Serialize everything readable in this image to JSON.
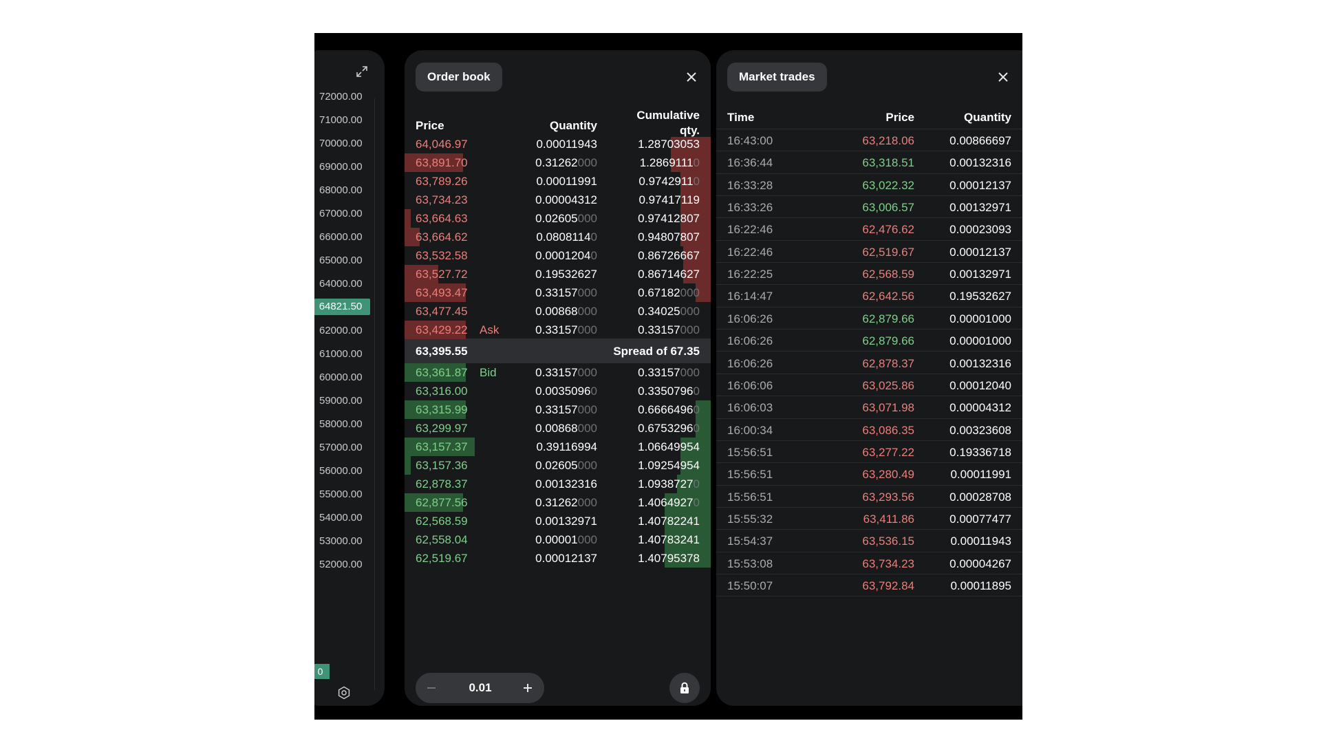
{
  "axis": {
    "labels": [
      "72000.00",
      "71000.00",
      "70000.00",
      "69000.00",
      "68000.00",
      "67000.00",
      "66000.00",
      "65000.00",
      "64000.00",
      "63000.00",
      "62000.00",
      "61000.00",
      "60000.00",
      "59000.00",
      "58000.00",
      "57000.00",
      "56000.00",
      "55000.00",
      "54000.00",
      "53000.00",
      "52000.00"
    ],
    "current_price": "64821.50",
    "zero_badge": "0"
  },
  "order_book": {
    "title": "Order book",
    "headers": {
      "price": "Price",
      "quantity": "Quantity",
      "cumulative": "Cumulative qty."
    },
    "asks": [
      {
        "price": "64,046.97",
        "qty": "0.00011943",
        "qty_dim": "",
        "cum": "1.28703053",
        "cum_dim": "",
        "size_pct": 0,
        "cum_pct": 13
      },
      {
        "price": "63,891.70",
        "qty": "0.31262",
        "qty_dim": "000",
        "cum": "1.2869111",
        "cum_dim": "0",
        "size_pct": 19,
        "cum_pct": 13
      },
      {
        "price": "63,789.26",
        "qty": "0.00011991",
        "qty_dim": "",
        "cum": "0.9742911",
        "cum_dim": "0",
        "size_pct": 0,
        "cum_pct": 10
      },
      {
        "price": "63,734.23",
        "qty": "0.00004312",
        "qty_dim": "",
        "cum": "0.97417119",
        "cum_dim": "",
        "size_pct": 0,
        "cum_pct": 10
      },
      {
        "price": "63,664.63",
        "qty": "0.02605",
        "qty_dim": "000",
        "cum": "0.97412807",
        "cum_dim": "",
        "size_pct": 2,
        "cum_pct": 10
      },
      {
        "price": "63,664.62",
        "qty": "0.0808114",
        "qty_dim": "0",
        "cum": "0.94807807",
        "cum_dim": "",
        "size_pct": 5,
        "cum_pct": 10
      },
      {
        "price": "63,532.58",
        "qty": "0.0001204",
        "qty_dim": "0",
        "cum": "0.86726667",
        "cum_dim": "",
        "size_pct": 0,
        "cum_pct": 9
      },
      {
        "price": "63,527.72",
        "qty": "0.19532627",
        "qty_dim": "",
        "cum": "0.86714627",
        "cum_dim": "",
        "size_pct": 11,
        "cum_pct": 9
      },
      {
        "price": "63,493.47",
        "qty": "0.33157",
        "qty_dim": "000",
        "cum": "0.67182",
        "cum_dim": "000",
        "size_pct": 20,
        "cum_pct": 5
      },
      {
        "price": "63,477.45",
        "qty": "0.00868",
        "qty_dim": "000",
        "cum": "0.34025",
        "cum_dim": "000",
        "size_pct": 0,
        "cum_pct": 0
      },
      {
        "price": "63,429.22",
        "qty": "0.33157",
        "qty_dim": "000",
        "cum": "0.33157",
        "cum_dim": "000",
        "size_pct": 20,
        "cum_pct": 0,
        "tag": "Ask"
      }
    ],
    "spread": {
      "price": "63,395.55",
      "label": "Spread of 67.35"
    },
    "bids": [
      {
        "price": "63,361.87",
        "qty": "0.33157",
        "qty_dim": "000",
        "cum": "0.33157",
        "cum_dim": "000",
        "size_pct": 20,
        "cum_pct": 0,
        "tag": "Bid"
      },
      {
        "price": "63,316.00",
        "qty": "0.0035096",
        "qty_dim": "0",
        "cum": "0.3350796",
        "cum_dim": "0",
        "size_pct": 0,
        "cum_pct": 0
      },
      {
        "price": "63,315.99",
        "qty": "0.33157",
        "qty_dim": "000",
        "cum": "0.6666496",
        "cum_dim": "0",
        "size_pct": 20,
        "cum_pct": 5
      },
      {
        "price": "63,299.97",
        "qty": "0.00868",
        "qty_dim": "000",
        "cum": "0.6753296",
        "cum_dim": "0",
        "size_pct": 0,
        "cum_pct": 5
      },
      {
        "price": "63,157.37",
        "qty": "0.39116994",
        "qty_dim": "",
        "cum": "1.06649954",
        "cum_dim": "",
        "size_pct": 23,
        "cum_pct": 10
      },
      {
        "price": "63,157.36",
        "qty": "0.02605",
        "qty_dim": "000",
        "cum": "1.09254954",
        "cum_dim": "",
        "size_pct": 2,
        "cum_pct": 10
      },
      {
        "price": "62,878.37",
        "qty": "0.00132316",
        "qty_dim": "",
        "cum": "1.0938727",
        "cum_dim": "0",
        "size_pct": 0,
        "cum_pct": 11
      },
      {
        "price": "62,877.56",
        "qty": "0.31262",
        "qty_dim": "000",
        "cum": "1.4064927",
        "cum_dim": "0",
        "size_pct": 19,
        "cum_pct": 15
      },
      {
        "price": "62,568.59",
        "qty": "0.00132971",
        "qty_dim": "",
        "cum": "1.40782241",
        "cum_dim": "",
        "size_pct": 0,
        "cum_pct": 15
      },
      {
        "price": "62,558.04",
        "qty": "0.00001",
        "qty_dim": "000",
        "cum": "1.40783241",
        "cum_dim": "",
        "size_pct": 0,
        "cum_pct": 15
      },
      {
        "price": "62,519.67",
        "qty": "0.00012137",
        "qty_dim": "",
        "cum": "1.40795378",
        "cum_dim": "",
        "size_pct": 0,
        "cum_pct": 15
      }
    ],
    "stepper": {
      "value": "0.01"
    }
  },
  "market_trades": {
    "title": "Market trades",
    "headers": {
      "time": "Time",
      "price": "Price",
      "quantity": "Quantity"
    },
    "rows": [
      {
        "time": "16:43:00",
        "price": "63,218.06",
        "side": "sell",
        "qty": "0.00866697"
      },
      {
        "time": "16:36:44",
        "price": "63,318.51",
        "side": "buy",
        "qty": "0.00132316"
      },
      {
        "time": "16:33:28",
        "price": "63,022.32",
        "side": "buy",
        "qty": "0.00012137"
      },
      {
        "time": "16:33:26",
        "price": "63,006.57",
        "side": "buy",
        "qty": "0.00132971"
      },
      {
        "time": "16:22:46",
        "price": "62,476.62",
        "side": "sell",
        "qty": "0.00023093"
      },
      {
        "time": "16:22:46",
        "price": "62,519.67",
        "side": "sell",
        "qty": "0.00012137"
      },
      {
        "time": "16:22:25",
        "price": "62,568.59",
        "side": "sell",
        "qty": "0.00132971"
      },
      {
        "time": "16:14:47",
        "price": "62,642.56",
        "side": "sell",
        "qty": "0.19532627"
      },
      {
        "time": "16:06:26",
        "price": "62,879.66",
        "side": "buy",
        "qty": "0.00001000"
      },
      {
        "time": "16:06:26",
        "price": "62,879.66",
        "side": "buy",
        "qty": "0.00001000"
      },
      {
        "time": "16:06:26",
        "price": "62,878.37",
        "side": "sell",
        "qty": "0.00132316"
      },
      {
        "time": "16:06:06",
        "price": "63,025.86",
        "side": "sell",
        "qty": "0.00012040"
      },
      {
        "time": "16:06:03",
        "price": "63,071.98",
        "side": "sell",
        "qty": "0.00004312"
      },
      {
        "time": "16:00:34",
        "price": "63,086.35",
        "side": "sell",
        "qty": "0.00323608"
      },
      {
        "time": "15:56:51",
        "price": "63,277.22",
        "side": "sell",
        "qty": "0.19336718"
      },
      {
        "time": "15:56:51",
        "price": "63,280.49",
        "side": "sell",
        "qty": "0.00011991"
      },
      {
        "time": "15:56:51",
        "price": "63,293.56",
        "side": "sell",
        "qty": "0.00028708"
      },
      {
        "time": "15:55:32",
        "price": "63,411.86",
        "side": "sell",
        "qty": "0.00077477"
      },
      {
        "time": "15:54:37",
        "price": "63,536.15",
        "side": "sell",
        "qty": "0.00011943"
      },
      {
        "time": "15:53:08",
        "price": "63,734.23",
        "side": "sell",
        "qty": "0.00004267"
      },
      {
        "time": "15:50:07",
        "price": "63,792.84",
        "side": "sell",
        "qty": "0.00011895"
      }
    ]
  },
  "icons": {
    "expand": "expand-icon",
    "close": "close-icon",
    "settings": "settings-icon",
    "minus": "minus-icon",
    "plus": "plus-icon",
    "lock": "lock-icon"
  },
  "colors": {
    "ask": "#ec7f7a",
    "bid": "#7fcf8b",
    "ask_bar": "#6b2b2b",
    "bid_bar": "#2a5a35",
    "price_badge": "#3f9478",
    "panel": "#18191b"
  }
}
